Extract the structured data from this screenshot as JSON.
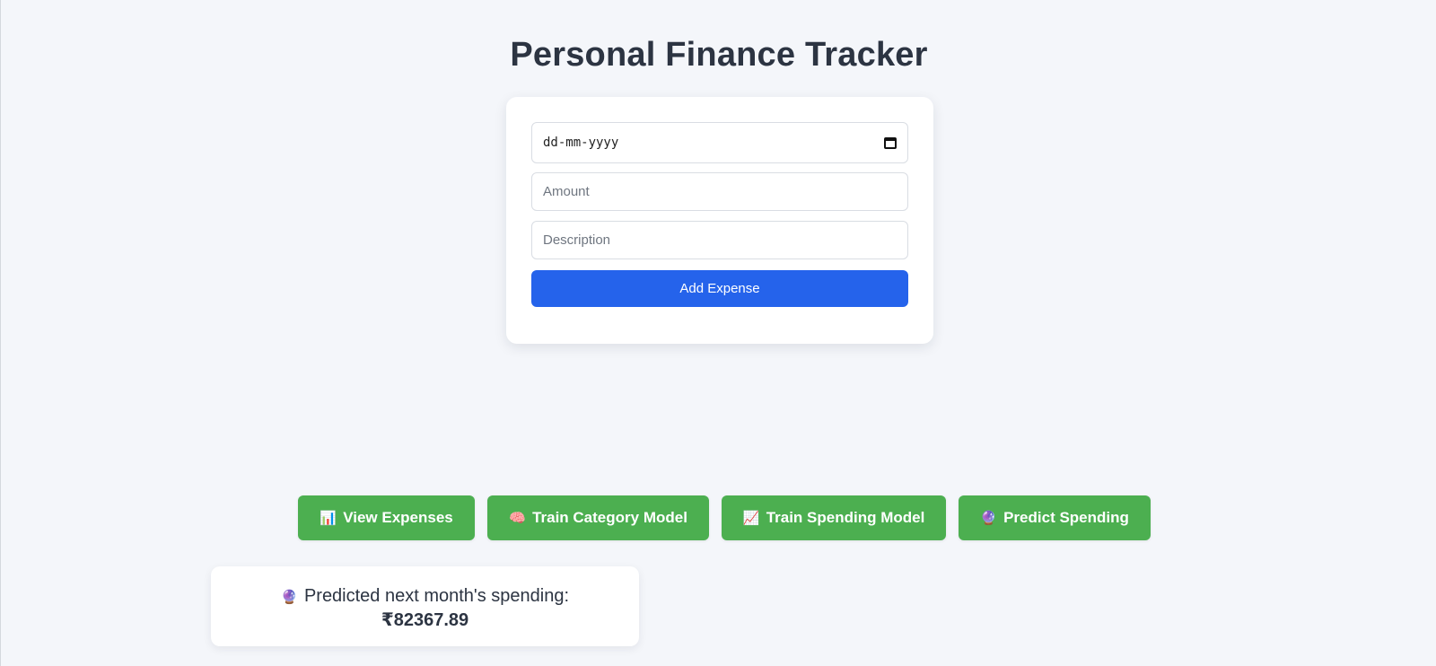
{
  "page": {
    "title": "Personal Finance Tracker"
  },
  "form": {
    "date_placeholder": "dd-mm-yyyy",
    "amount_placeholder": "Amount",
    "description_placeholder": "Description",
    "submit_label": "Add Expense"
  },
  "actions": [
    {
      "icon": "📊",
      "label": "View Expenses"
    },
    {
      "icon": "🧠",
      "label": "Train Category Model"
    },
    {
      "icon": "📈",
      "label": "Train Spending Model"
    },
    {
      "icon": "🔮",
      "label": "Predict Spending"
    }
  ],
  "result": {
    "icon": "🔮",
    "label": "Predicted next month's spending:",
    "value": "₹82367.89"
  },
  "colors": {
    "primary_button": "#2563eb",
    "action_button": "#4caf50",
    "background": "#f4f6fa",
    "title_text": "#2c3442"
  }
}
